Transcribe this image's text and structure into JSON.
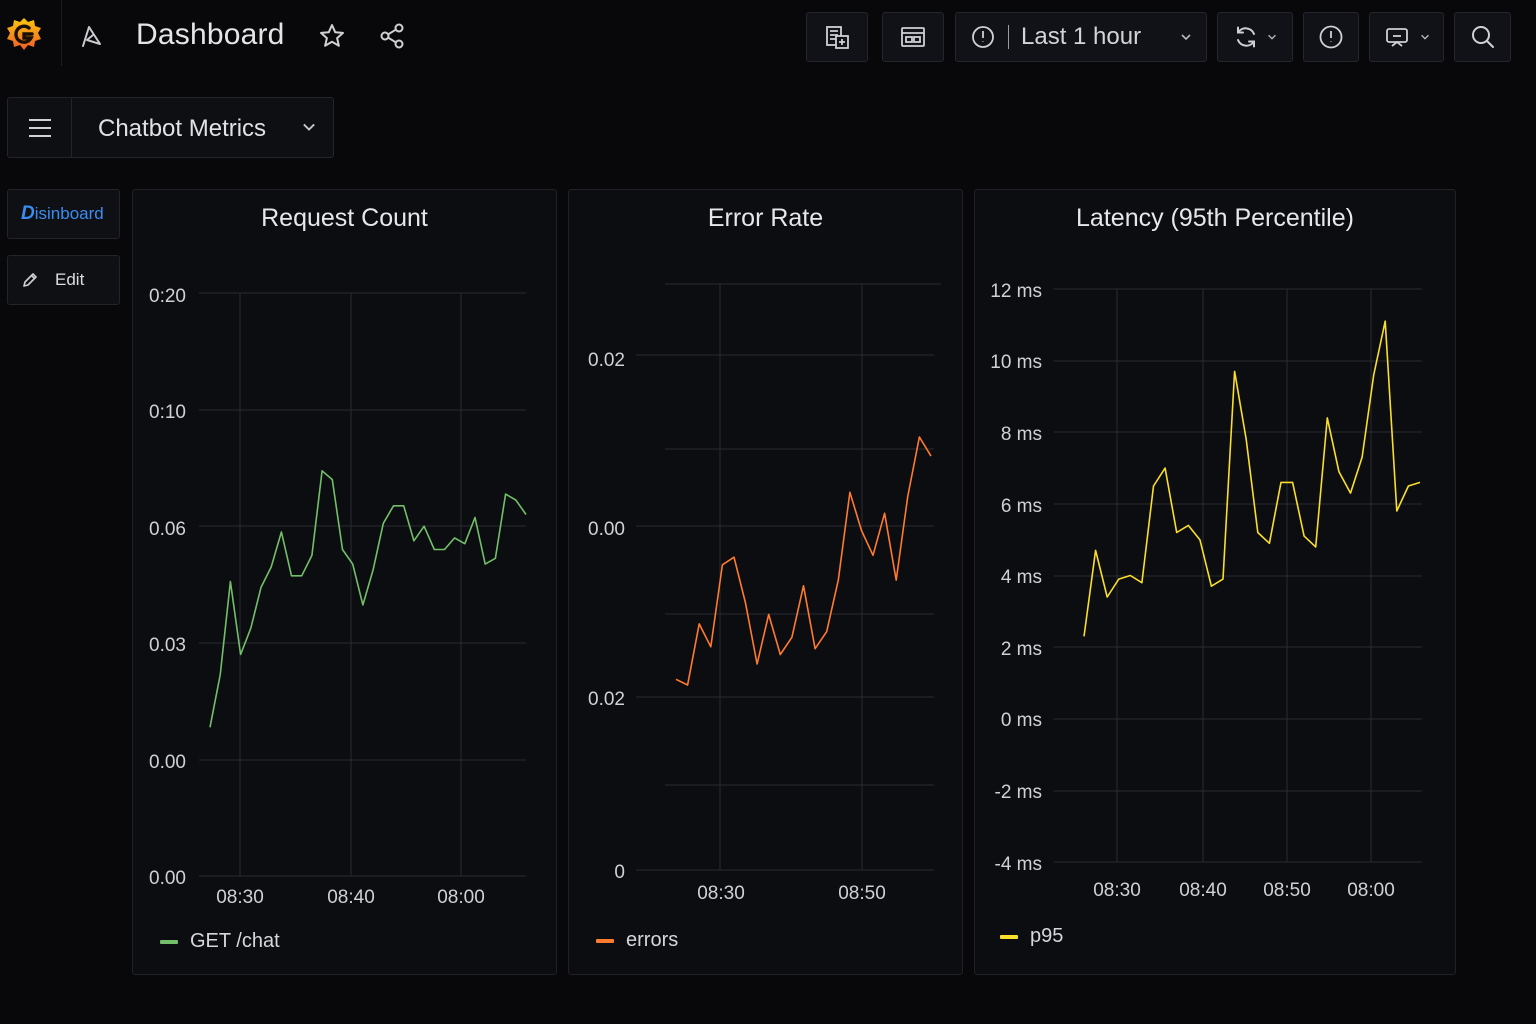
{
  "header": {
    "title": "Dashboard",
    "time_range": "Last 1 hour"
  },
  "dashboard": {
    "name": "Chatbot Metrics"
  },
  "sidebar": {
    "brand_letter": "D",
    "brand_text": "isinboard",
    "edit_label": "Edit"
  },
  "colors": {
    "request_series": "#73bf69",
    "error_series": "#ff7b2e",
    "latency_series": "#fade2a"
  },
  "panels": [
    {
      "title": "Request Count",
      "legend": "GET /chat",
      "y_ticks": [
        "0:20",
        "0:10",
        "0.06",
        "0.03",
        "0.00",
        "0.00"
      ],
      "x_ticks": [
        "08:30",
        "08:40",
        "08:00"
      ]
    },
    {
      "title": "Error Rate",
      "legend": "errors",
      "y_ticks": [
        "0.02",
        "0.00",
        "0.02",
        "0"
      ],
      "x_ticks": [
        "08:30",
        "08:50"
      ]
    },
    {
      "title": "Latency (95th Percentile)",
      "legend": "p95",
      "y_ticks": [
        "12 ms",
        "10 ms",
        "8 ms",
        "6 ms",
        "4 ms",
        "2 ms",
        "0 ms",
        "-2 ms",
        "-4 ms"
      ],
      "x_ticks": [
        "08:30",
        "08:40",
        "08:50",
        "08:00"
      ]
    }
  ],
  "chart_data": [
    {
      "type": "line",
      "title": "Request Count",
      "series": [
        {
          "name": "GET /chat",
          "color": "#73bf69",
          "values": [
            0.051,
            0.069,
            0.101,
            0.076,
            0.085,
            0.099,
            0.106,
            0.118,
            0.103,
            0.103,
            0.11,
            0.139,
            0.136,
            0.112,
            0.107,
            0.093,
            0.105,
            0.121,
            0.127,
            0.127,
            0.115,
            0.12,
            0.112,
            0.112,
            0.116,
            0.114,
            0.123,
            0.107,
            0.109,
            0.131,
            0.129,
            0.124
          ]
        }
      ],
      "y_range": [
        0,
        0.2
      ],
      "grid": true,
      "legend_position": "bottom-left"
    },
    {
      "type": "line",
      "title": "Error Rate",
      "series": [
        {
          "name": "errors",
          "color": "#ff7b2e",
          "values": [
            0.018,
            0.0177,
            0.0209,
            0.0197,
            0.024,
            0.0244,
            0.022,
            0.0188,
            0.0214,
            0.0193,
            0.0202,
            0.0229,
            0.0196,
            0.0205,
            0.0232,
            0.0278,
            0.0258,
            0.0245,
            0.0267,
            0.0232,
            0.0276,
            0.0307,
            0.0297
          ]
        }
      ],
      "grid": true,
      "legend_position": "bottom-left"
    },
    {
      "type": "line",
      "title": "Latency (95th Percentile)",
      "series": [
        {
          "name": "p95",
          "color": "#fade2a",
          "values": [
            2.3,
            4.7,
            3.4,
            3.9,
            4.0,
            3.8,
            6.5,
            7.0,
            5.2,
            5.4,
            5.0,
            3.7,
            3.9,
            9.7,
            7.8,
            5.2,
            4.9,
            6.6,
            6.6,
            5.1,
            4.8,
            8.4,
            6.9,
            6.3,
            7.3,
            9.6,
            11.1,
            5.8,
            6.5,
            6.6
          ]
        }
      ],
      "y_range": [
        -4,
        12
      ],
      "unit": "ms",
      "grid": true,
      "legend_position": "bottom-left"
    }
  ]
}
